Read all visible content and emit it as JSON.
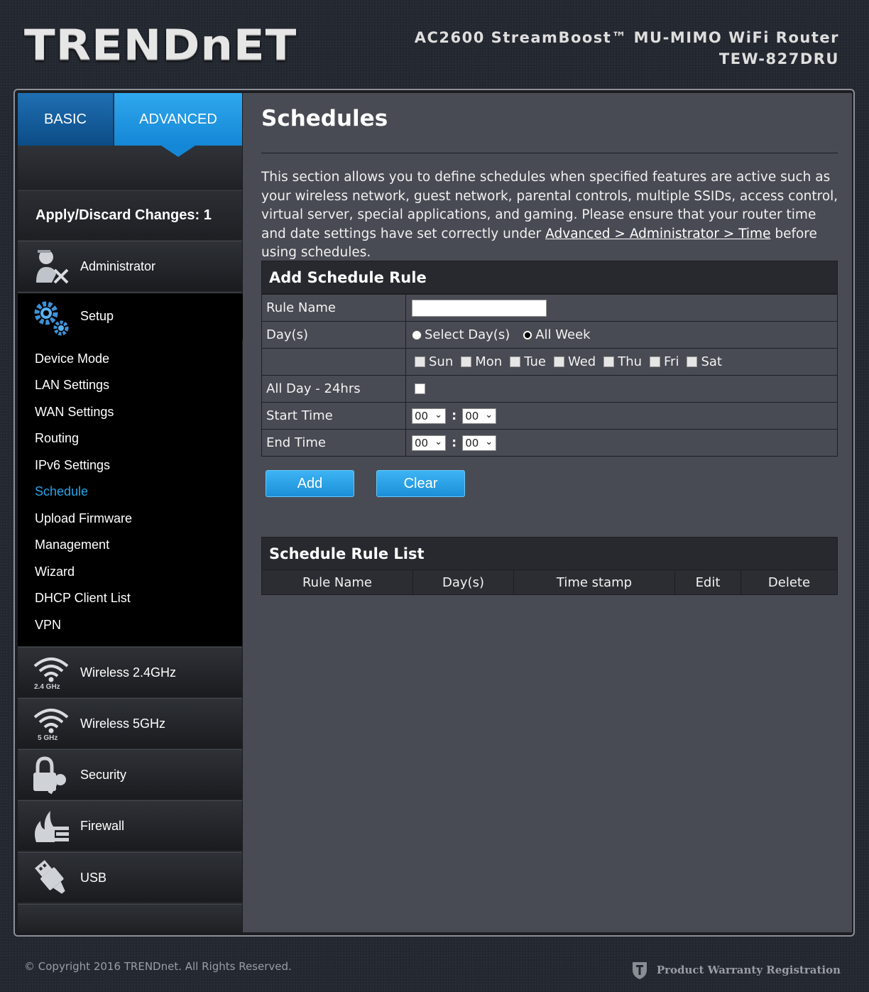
{
  "brand": {
    "logo": "TRENDnET",
    "product_line1": "AC2600 StreamBoost™ MU-MIMO WiFi Router",
    "product_line2": "TEW-827DRU"
  },
  "tabs": {
    "basic": "BASIC",
    "advanced": "ADVANCED"
  },
  "apply_label": "Apply/Discard Changes: 1",
  "sidebar": {
    "administrator": "Administrator",
    "setup": "Setup",
    "setup_items": [
      "Device Mode",
      "LAN Settings",
      "WAN Settings",
      "Routing",
      "IPv6 Settings",
      "Schedule",
      "Upload Firmware",
      "Management",
      "Wizard",
      "DHCP Client List",
      "VPN"
    ],
    "active_item": "Schedule",
    "wireless24": "Wireless 2.4GHz",
    "wireless24_sub": "2.4 GHz",
    "wireless5": "Wireless 5GHz",
    "wireless5_sub": "5 GHz",
    "security": "Security",
    "firewall": "Firewall",
    "usb": "USB"
  },
  "main": {
    "title": "Schedules",
    "intro_text": "This section allows you to define schedules when specified features are active such as your wireless network, guest network, parental controls, multiple SSIDs, access control, virtual server, special applications, and gaming. Please ensure that your router time and date settings have set correctly under ",
    "intro_link": "Advanced > Administrator > Time",
    "intro_tail": " before using schedules.",
    "add_rule": {
      "heading": "Add Schedule Rule",
      "rule_name_label": "Rule Name",
      "rule_name_value": "",
      "days_label": "Day(s)",
      "select_days": "Select Day(s)",
      "all_week": "All Week",
      "days": [
        "Sun",
        "Mon",
        "Tue",
        "Wed",
        "Thu",
        "Fri",
        "Sat"
      ],
      "all_day_label": "All Day - 24hrs",
      "start_label": "Start Time",
      "end_label": "End Time",
      "start_hour": "00",
      "start_min": "00",
      "end_hour": "00",
      "end_min": "00",
      "colon": ":"
    },
    "buttons": {
      "add": "Add",
      "clear": "Clear"
    },
    "rule_list": {
      "heading": "Schedule Rule List",
      "columns": [
        "Rule Name",
        "Day(s)",
        "Time stamp",
        "Edit",
        "Delete"
      ]
    }
  },
  "footer": {
    "copyright": "© Copyright 2016 TRENDnet. All Rights Reserved.",
    "warranty": "Product Warranty Registration"
  },
  "colors": {
    "accent": "#28a3e6",
    "button": "#1b8fd8",
    "panel": "#484b53"
  }
}
